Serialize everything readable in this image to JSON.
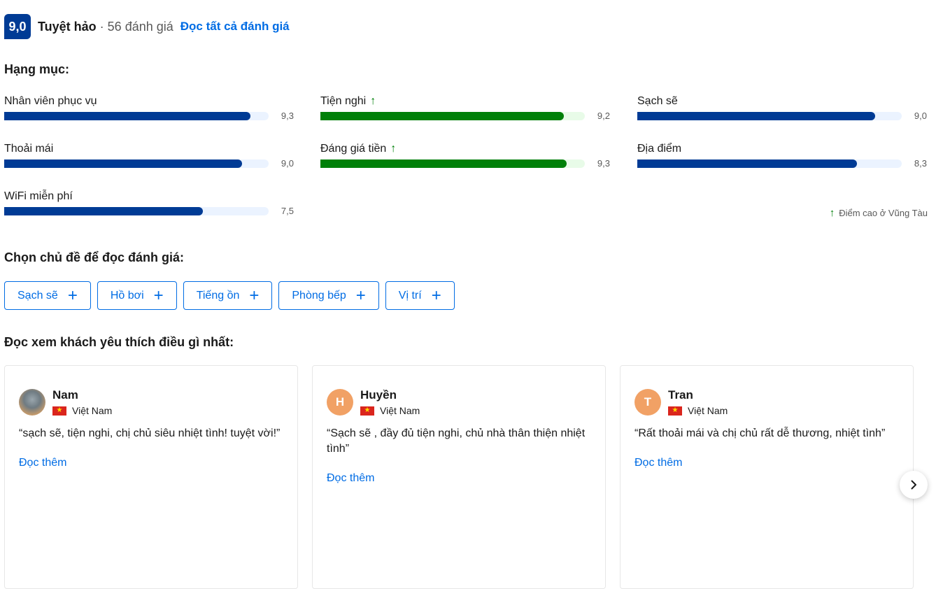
{
  "summary": {
    "score": "9,0",
    "label": "Tuyệt hảo",
    "separator": "·",
    "review_count": "56 đánh giá",
    "read_all": "Đọc tất cả đánh giá"
  },
  "categories_title": "Hạng mục:",
  "categories": [
    {
      "name": "Nhân viên phục vụ",
      "score": "9,3",
      "value": 9.3,
      "trend_up": false
    },
    {
      "name": "Tiện nghi",
      "score": "9,2",
      "value": 9.2,
      "trend_up": true
    },
    {
      "name": "Sạch sẽ",
      "score": "9,0",
      "value": 9.0,
      "trend_up": false
    },
    {
      "name": "Thoải mái",
      "score": "9,0",
      "value": 9.0,
      "trend_up": false
    },
    {
      "name": "Đáng giá tiền",
      "score": "9,3",
      "value": 9.3,
      "trend_up": true
    },
    {
      "name": "Địa điểm",
      "score": "8,3",
      "value": 8.3,
      "trend_up": false
    },
    {
      "name": "WiFi miễn phí",
      "score": "7,5",
      "value": 7.5,
      "trend_up": false
    }
  ],
  "score_max": 10,
  "local_note": "Điểm cao ở Vũng Tàu",
  "topics_title": "Chọn chủ đề để đọc đánh giá:",
  "topics": [
    "Sạch sẽ",
    "Hồ bơi",
    "Tiếng ồn",
    "Phòng bếp",
    "Vị trí"
  ],
  "loved_title": "Đọc xem khách yêu thích điều gì nhất:",
  "reviews": [
    {
      "name": "Nam",
      "initial": "",
      "country": "Việt Nam",
      "quote": "“sạch sẽ, tiện nghi, chị chủ siêu nhiệt tình! tuyệt vời!”",
      "read_more": "Đọc thêm"
    },
    {
      "name": "Huyền",
      "initial": "H",
      "country": "Việt Nam",
      "quote": "“Sạch sẽ , đầy đủ tiện nghi, chủ nhà thân thiện nhiệt tình”",
      "read_more": "Đọc thêm"
    },
    {
      "name": "Tran",
      "initial": "T",
      "country": "Việt Nam",
      "quote": "“Rất thoải mái và chị chủ rất dễ thương, nhiệt tình”",
      "read_more": "Đọc thêm"
    }
  ],
  "colors": {
    "primary": "#003b95",
    "link": "#006ce4",
    "good": "#008009"
  },
  "icons": {
    "up_arrow": "arrow-up-icon",
    "plus": "plus-icon",
    "next": "chevron-right-icon",
    "flag": "vietnam-flag-icon"
  }
}
